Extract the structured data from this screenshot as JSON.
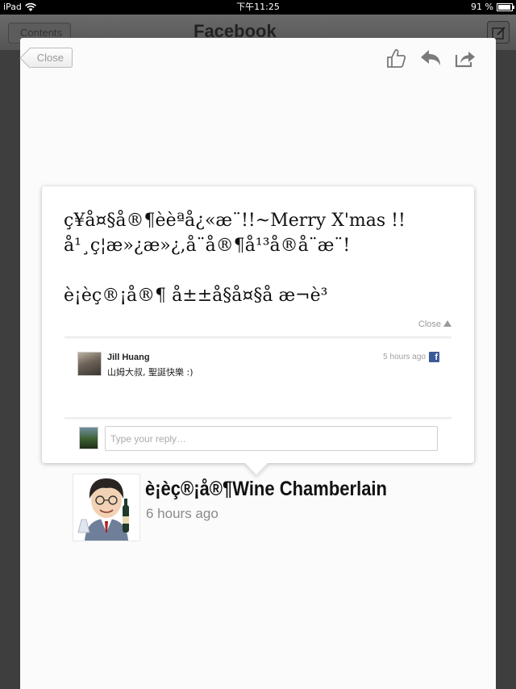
{
  "status_bar": {
    "device": "iPad",
    "time": "下午11:25",
    "battery_text": "91 %",
    "battery_level": 0.91
  },
  "background_app": {
    "back_button": "Contents",
    "title": "Facebook"
  },
  "modal": {
    "close_label": "Close",
    "actions": [
      "thumbs-up-icon",
      "reply-icon",
      "share-icon"
    ]
  },
  "post": {
    "body_lines": [
      "ç¥å¤§å®¶èèªå¿«æ¨!!~Merry X'mas !!",
      "å¹¸ç¦æ»¿æ»¿,å¨å®¶å¹³å®å¨æ¨!"
    ],
    "signature": "è¡èç®¡å®¶ å±±å§å¤§å æ¬è³",
    "collapse_label": "Close"
  },
  "comment": {
    "author": "Jill Huang",
    "time": "5 hours ago",
    "text": "山姆大叔, 聖誕快樂 :)"
  },
  "reply": {
    "placeholder": "Type your reply…"
  },
  "author": {
    "name": "è¡èç®¡å®¶Wine Chamberlain",
    "time": "6 hours ago"
  },
  "colors": {
    "facebook_blue": "#3b5998",
    "dim_background": "#3e3e3e",
    "modal_background": "#fbfbfb"
  }
}
